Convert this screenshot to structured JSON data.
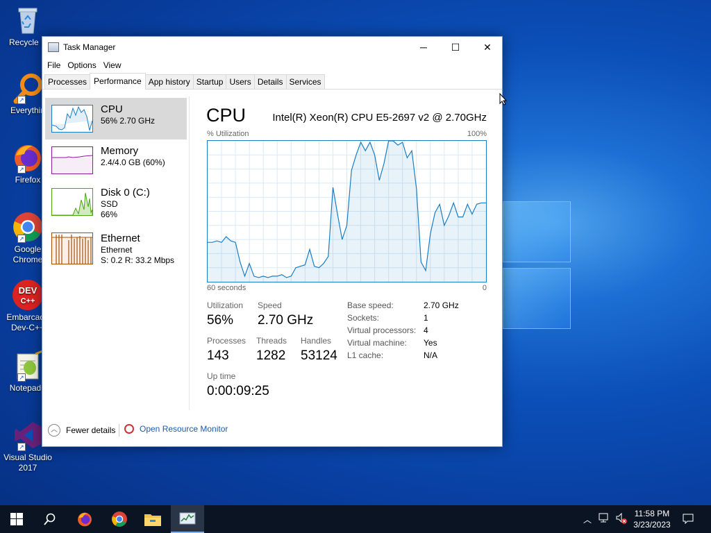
{
  "desktop": {
    "icons": [
      {
        "label": "Recycle Bin",
        "icon": "recycle-bin-icon"
      },
      {
        "label": "Everything",
        "icon": "everything-icon"
      },
      {
        "label": "Firefox",
        "icon": "firefox-icon"
      },
      {
        "label": "Google Chrome",
        "icon": "chrome-icon"
      },
      {
        "label": "Embarcadero Dev-C++",
        "icon": "devcpp-icon"
      },
      {
        "label": "Notepad++",
        "icon": "notepadpp-icon"
      },
      {
        "label": "Visual Studio 2017",
        "icon": "visual-studio-icon"
      }
    ],
    "recycle_visible": "Recycle B",
    "everything_visible": "Everythin",
    "chrome_line1": "Google",
    "chrome_line2": "Chrome",
    "devcpp_line1": "Embarcade",
    "devcpp_line2": "Dev-C++",
    "npp_visible": "Notepad+",
    "vs_line1": "Visual Studio",
    "vs_line2": "2017",
    "firefox_label": "Firefox",
    "devcpp_icon_text1": "DEV",
    "devcpp_icon_text2": "C++"
  },
  "window": {
    "title": "Task Manager",
    "minimize": "─",
    "maximize": "☐",
    "close": "✕",
    "menu": [
      "File",
      "Options",
      "View"
    ],
    "tabs": [
      "Processes",
      "Performance",
      "App history",
      "Startup",
      "Users",
      "Details",
      "Services"
    ],
    "active_tab": "Performance"
  },
  "sidebar": {
    "items": [
      {
        "name": "CPU",
        "line1": "56%  2.70 GHz",
        "line2": "",
        "color": "#1a7dc4"
      },
      {
        "name": "Memory",
        "line1": "2.4/4.0 GB (60%)",
        "line2": "",
        "color": "#8b1a9c"
      },
      {
        "name": "Disk 0 (C:)",
        "line1": "SSD",
        "line2": "66%",
        "color": "#4da60c"
      },
      {
        "name": "Ethernet",
        "line1": "Ethernet",
        "line2": "S: 0.2  R: 33.2 Mbps",
        "color": "#a74f01"
      }
    ]
  },
  "main": {
    "title": "CPU",
    "model": "Intel(R) Xeon(R) CPU E5-2697 v2 @ 2.70GHz",
    "y_label": "% Utilization",
    "y_max": "100%",
    "x_left": "60 seconds",
    "x_right": "0",
    "stats": {
      "utilization_label": "Utilization",
      "utilization": "56%",
      "speed_label": "Speed",
      "speed": "2.70 GHz",
      "processes_label": "Processes",
      "processes": "143",
      "threads_label": "Threads",
      "threads": "1282",
      "handles_label": "Handles",
      "handles": "53124",
      "uptime_label": "Up time",
      "uptime": "0:00:09:25"
    },
    "info": [
      {
        "label": "Base speed:",
        "value": "2.70 GHz"
      },
      {
        "label": "Sockets:",
        "value": "1"
      },
      {
        "label": "Virtual processors:",
        "value": "4"
      },
      {
        "label": "Virtual machine:",
        "value": "Yes"
      },
      {
        "label": "L1 cache:",
        "value": "N/A"
      }
    ]
  },
  "chart_data": {
    "type": "area",
    "ylim": [
      0,
      100
    ],
    "xlim": [
      60,
      0
    ],
    "x": [
      60,
      59,
      58,
      57,
      56,
      55,
      54,
      53,
      52,
      51,
      50,
      49,
      48,
      47,
      46,
      45,
      44,
      43,
      42,
      41,
      40,
      39,
      38,
      37,
      36,
      35,
      34,
      33,
      32,
      31,
      30,
      29,
      28,
      27,
      26,
      25,
      24,
      23,
      22,
      21,
      20,
      19,
      18,
      17,
      16,
      15,
      14,
      13,
      12,
      11,
      10,
      9,
      8,
      7,
      6,
      5,
      4,
      3,
      2,
      1,
      0
    ],
    "values": [
      28,
      28,
      29,
      28,
      32,
      29,
      28,
      14,
      4,
      13,
      4,
      3,
      4,
      3,
      4,
      4,
      5,
      3,
      4,
      10,
      11,
      12,
      23,
      11,
      10,
      13,
      18,
      67,
      48,
      30,
      40,
      79,
      90,
      99,
      93,
      99,
      90,
      72,
      84,
      100,
      100,
      97,
      99,
      88,
      93,
      66,
      14,
      8,
      34,
      49,
      55,
      40,
      47,
      56,
      46,
      46,
      55,
      48,
      55,
      56,
      56
    ],
    "accent": "#1a7dc4"
  },
  "footer": {
    "fewer_details": "Fewer details",
    "open_resource_monitor": "Open Resource Monitor"
  },
  "taskbar": {
    "items": [
      "start-icon",
      "search-icon",
      "firefox-icon",
      "chrome-icon",
      "file-explorer-icon",
      "task-manager-icon"
    ],
    "time": "11:58 PM",
    "date": "3/23/2023"
  }
}
